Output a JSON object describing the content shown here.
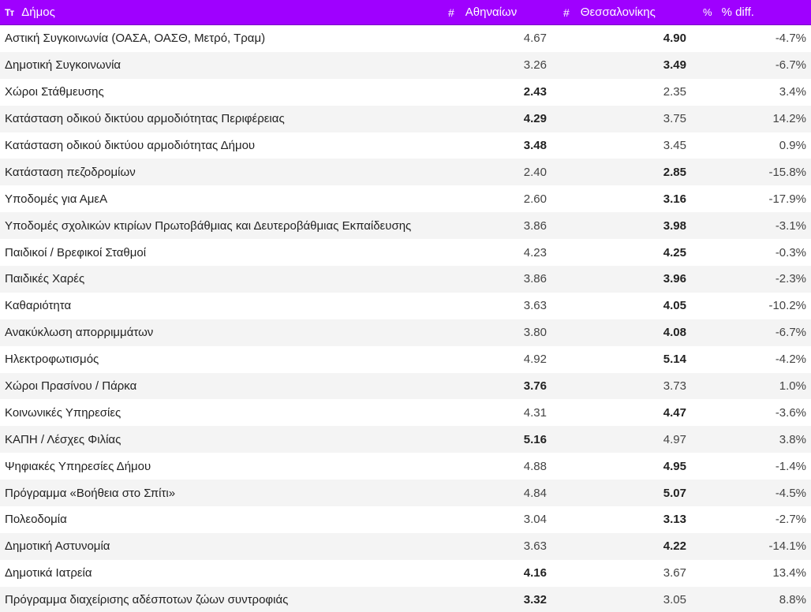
{
  "header": {
    "col_name": "Δήμος",
    "col_ath": "Αθηναίων",
    "col_the": "Θεσσαλονίκης",
    "col_diff": "% diff.",
    "icons": {
      "text_type": "Tт",
      "number_type": "#",
      "percent_type": "%"
    },
    "bg_color": "#9f00ff"
  },
  "rows": [
    {
      "name": "Αστική Συγκοινωνία (ΟΑΣΑ, ΟΑΣΘ, Μετρό, Τραμ)",
      "ath": "4.67",
      "the": "4.90",
      "diff": "-4.7%",
      "bold": "the"
    },
    {
      "name": "Δημοτική Συγκοινωνία",
      "ath": "3.26",
      "the": "3.49",
      "diff": "-6.7%",
      "bold": "the"
    },
    {
      "name": "Χώροι Στάθμευσης",
      "ath": "2.43",
      "the": "2.35",
      "diff": "3.4%",
      "bold": "ath"
    },
    {
      "name": "Κατάσταση οδικού δικτύου αρμοδιότητας Περιφέρειας",
      "ath": "4.29",
      "the": "3.75",
      "diff": "14.2%",
      "bold": "ath"
    },
    {
      "name": "Κατάσταση οδικού δικτύου αρμοδιότητας Δήμου",
      "ath": "3.48",
      "the": "3.45",
      "diff": "0.9%",
      "bold": "ath"
    },
    {
      "name": "Κατάσταση πεζοδρομίων",
      "ath": "2.40",
      "the": "2.85",
      "diff": "-15.8%",
      "bold": "the"
    },
    {
      "name": "Υποδομές για ΑμεΑ",
      "ath": "2.60",
      "the": "3.16",
      "diff": "-17.9%",
      "bold": "the"
    },
    {
      "name": "Υποδομές σχολικών κτιρίων Πρωτοβάθμιας και Δευτεροβάθμιας Εκπαίδευσης",
      "ath": "3.86",
      "the": "3.98",
      "diff": "-3.1%",
      "bold": "the"
    },
    {
      "name": "Παιδικοί / Βρεφικοί Σταθμοί",
      "ath": "4.23",
      "the": "4.25",
      "diff": "-0.3%",
      "bold": "the"
    },
    {
      "name": "Παιδικές Χαρές",
      "ath": "3.86",
      "the": "3.96",
      "diff": "-2.3%",
      "bold": "the"
    },
    {
      "name": "Καθαριότητα",
      "ath": "3.63",
      "the": "4.05",
      "diff": "-10.2%",
      "bold": "the"
    },
    {
      "name": "Ανακύκλωση απορριμμάτων",
      "ath": "3.80",
      "the": "4.08",
      "diff": "-6.7%",
      "bold": "the"
    },
    {
      "name": "Ηλεκτροφωτισμός",
      "ath": "4.92",
      "the": "5.14",
      "diff": "-4.2%",
      "bold": "the"
    },
    {
      "name": "Χώροι Πρασίνου / Πάρκα",
      "ath": "3.76",
      "the": "3.73",
      "diff": "1.0%",
      "bold": "ath"
    },
    {
      "name": "Κοινωνικές Υπηρεσίες",
      "ath": "4.31",
      "the": "4.47",
      "diff": "-3.6%",
      "bold": "the"
    },
    {
      "name": "ΚΑΠΗ / Λέσχες Φιλίας",
      "ath": "5.16",
      "the": "4.97",
      "diff": "3.8%",
      "bold": "ath"
    },
    {
      "name": "Ψηφιακές Υπηρεσίες Δήμου",
      "ath": "4.88",
      "the": "4.95",
      "diff": "-1.4%",
      "bold": "the"
    },
    {
      "name": "Πρόγραμμα «Βοήθεια στο Σπίτι»",
      "ath": "4.84",
      "the": "5.07",
      "diff": "-4.5%",
      "bold": "the"
    },
    {
      "name": "Πολεοδομία",
      "ath": "3.04",
      "the": "3.13",
      "diff": "-2.7%",
      "bold": "the"
    },
    {
      "name": "Δημοτική Αστυνομία",
      "ath": "3.63",
      "the": "4.22",
      "diff": "-14.1%",
      "bold": "the"
    },
    {
      "name": "Δημοτικά Ιατρεία",
      "ath": "4.16",
      "the": "3.67",
      "diff": "13.4%",
      "bold": "ath"
    },
    {
      "name": "Πρόγραμμα διαχείρισης αδέσποτων ζώων συντροφιάς",
      "ath": "3.32",
      "the": "3.05",
      "diff": "8.8%",
      "bold": "ath"
    }
  ]
}
